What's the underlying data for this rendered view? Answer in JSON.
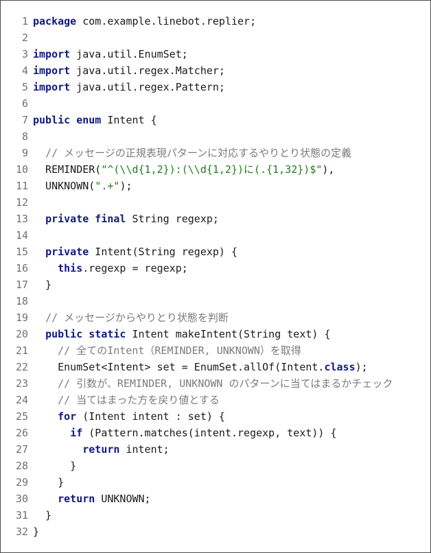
{
  "code": {
    "language": "java",
    "lines": [
      {
        "n": "1",
        "tokens": [
          [
            "kw",
            "package"
          ],
          [
            "plain",
            " com.example.linebot.replier;"
          ]
        ]
      },
      {
        "n": "2",
        "tokens": []
      },
      {
        "n": "3",
        "tokens": [
          [
            "kw",
            "import"
          ],
          [
            "plain",
            " java.util.EnumSet;"
          ]
        ]
      },
      {
        "n": "4",
        "tokens": [
          [
            "kw",
            "import"
          ],
          [
            "plain",
            " java.util.regex.Matcher;"
          ]
        ]
      },
      {
        "n": "5",
        "tokens": [
          [
            "kw",
            "import"
          ],
          [
            "plain",
            " java.util.regex.Pattern;"
          ]
        ]
      },
      {
        "n": "6",
        "tokens": []
      },
      {
        "n": "7",
        "tokens": [
          [
            "kw",
            "public enum"
          ],
          [
            "plain",
            " Intent {"
          ]
        ]
      },
      {
        "n": "8",
        "tokens": []
      },
      {
        "n": "9",
        "tokens": [
          [
            "plain",
            "  "
          ],
          [
            "cmt",
            "// メッセージの正規表現パターンに対応するやりとり状態の定義"
          ]
        ]
      },
      {
        "n": "10",
        "tokens": [
          [
            "plain",
            "  REMINDER("
          ],
          [
            "str",
            "\"^(\\\\d{1,2}):(\\\\d{1,2})に(.{1,32})$\""
          ],
          [
            "plain",
            "),"
          ]
        ]
      },
      {
        "n": "11",
        "tokens": [
          [
            "plain",
            "  UNKNOWN("
          ],
          [
            "str",
            "\".+\""
          ],
          [
            "plain",
            ");"
          ]
        ]
      },
      {
        "n": "12",
        "tokens": []
      },
      {
        "n": "13",
        "tokens": [
          [
            "plain",
            "  "
          ],
          [
            "kw",
            "private final"
          ],
          [
            "plain",
            " String regexp;"
          ]
        ]
      },
      {
        "n": "14",
        "tokens": []
      },
      {
        "n": "15",
        "tokens": [
          [
            "plain",
            "  "
          ],
          [
            "kw",
            "private"
          ],
          [
            "plain",
            " Intent(String regexp) {"
          ]
        ]
      },
      {
        "n": "16",
        "tokens": [
          [
            "plain",
            "    "
          ],
          [
            "kw",
            "this"
          ],
          [
            "plain",
            ".regexp = regexp;"
          ]
        ]
      },
      {
        "n": "17",
        "tokens": [
          [
            "plain",
            "  }"
          ]
        ]
      },
      {
        "n": "18",
        "tokens": []
      },
      {
        "n": "19",
        "tokens": [
          [
            "plain",
            "  "
          ],
          [
            "cmt",
            "// メッセージからやりとり状態を判断"
          ]
        ]
      },
      {
        "n": "20",
        "tokens": [
          [
            "plain",
            "  "
          ],
          [
            "kw",
            "public static"
          ],
          [
            "plain",
            " Intent makeIntent(String text) {"
          ]
        ]
      },
      {
        "n": "21",
        "tokens": [
          [
            "plain",
            "    "
          ],
          [
            "cmt",
            "// 全てのIntent（REMINDER, UNKNOWN）を取得"
          ]
        ]
      },
      {
        "n": "22",
        "tokens": [
          [
            "plain",
            "    EnumSet<Intent> set = EnumSet.allOf(Intent."
          ],
          [
            "kw",
            "class"
          ],
          [
            "plain",
            ");"
          ]
        ]
      },
      {
        "n": "23",
        "tokens": [
          [
            "plain",
            "    "
          ],
          [
            "cmt",
            "// 引数が、REMINDER, UNKNOWN のパターンに当てはまるかチェック"
          ]
        ]
      },
      {
        "n": "24",
        "tokens": [
          [
            "plain",
            "    "
          ],
          [
            "cmt",
            "// 当てはまった方を戻り値とする"
          ]
        ]
      },
      {
        "n": "25",
        "tokens": [
          [
            "plain",
            "    "
          ],
          [
            "kw",
            "for"
          ],
          [
            "plain",
            " (Intent intent : set) {"
          ]
        ]
      },
      {
        "n": "26",
        "tokens": [
          [
            "plain",
            "      "
          ],
          [
            "kw",
            "if"
          ],
          [
            "plain",
            " (Pattern.matches(intent.regexp, text)) {"
          ]
        ]
      },
      {
        "n": "27",
        "tokens": [
          [
            "plain",
            "        "
          ],
          [
            "kw",
            "return"
          ],
          [
            "plain",
            " intent;"
          ]
        ]
      },
      {
        "n": "28",
        "tokens": [
          [
            "plain",
            "      }"
          ]
        ]
      },
      {
        "n": "29",
        "tokens": [
          [
            "plain",
            "    }"
          ]
        ]
      },
      {
        "n": "30",
        "tokens": [
          [
            "plain",
            "    "
          ],
          [
            "kw",
            "return"
          ],
          [
            "plain",
            " UNKNOWN;"
          ]
        ]
      },
      {
        "n": "31",
        "tokens": [
          [
            "plain",
            "  }"
          ]
        ]
      },
      {
        "n": "32",
        "tokens": [
          [
            "plain",
            "}"
          ]
        ]
      }
    ]
  },
  "colors": {
    "keyword": "#0f1887",
    "string": "#1f7d1f",
    "comment": "#7b7b7b",
    "line_number": "#707070",
    "background": "#ffffff"
  }
}
